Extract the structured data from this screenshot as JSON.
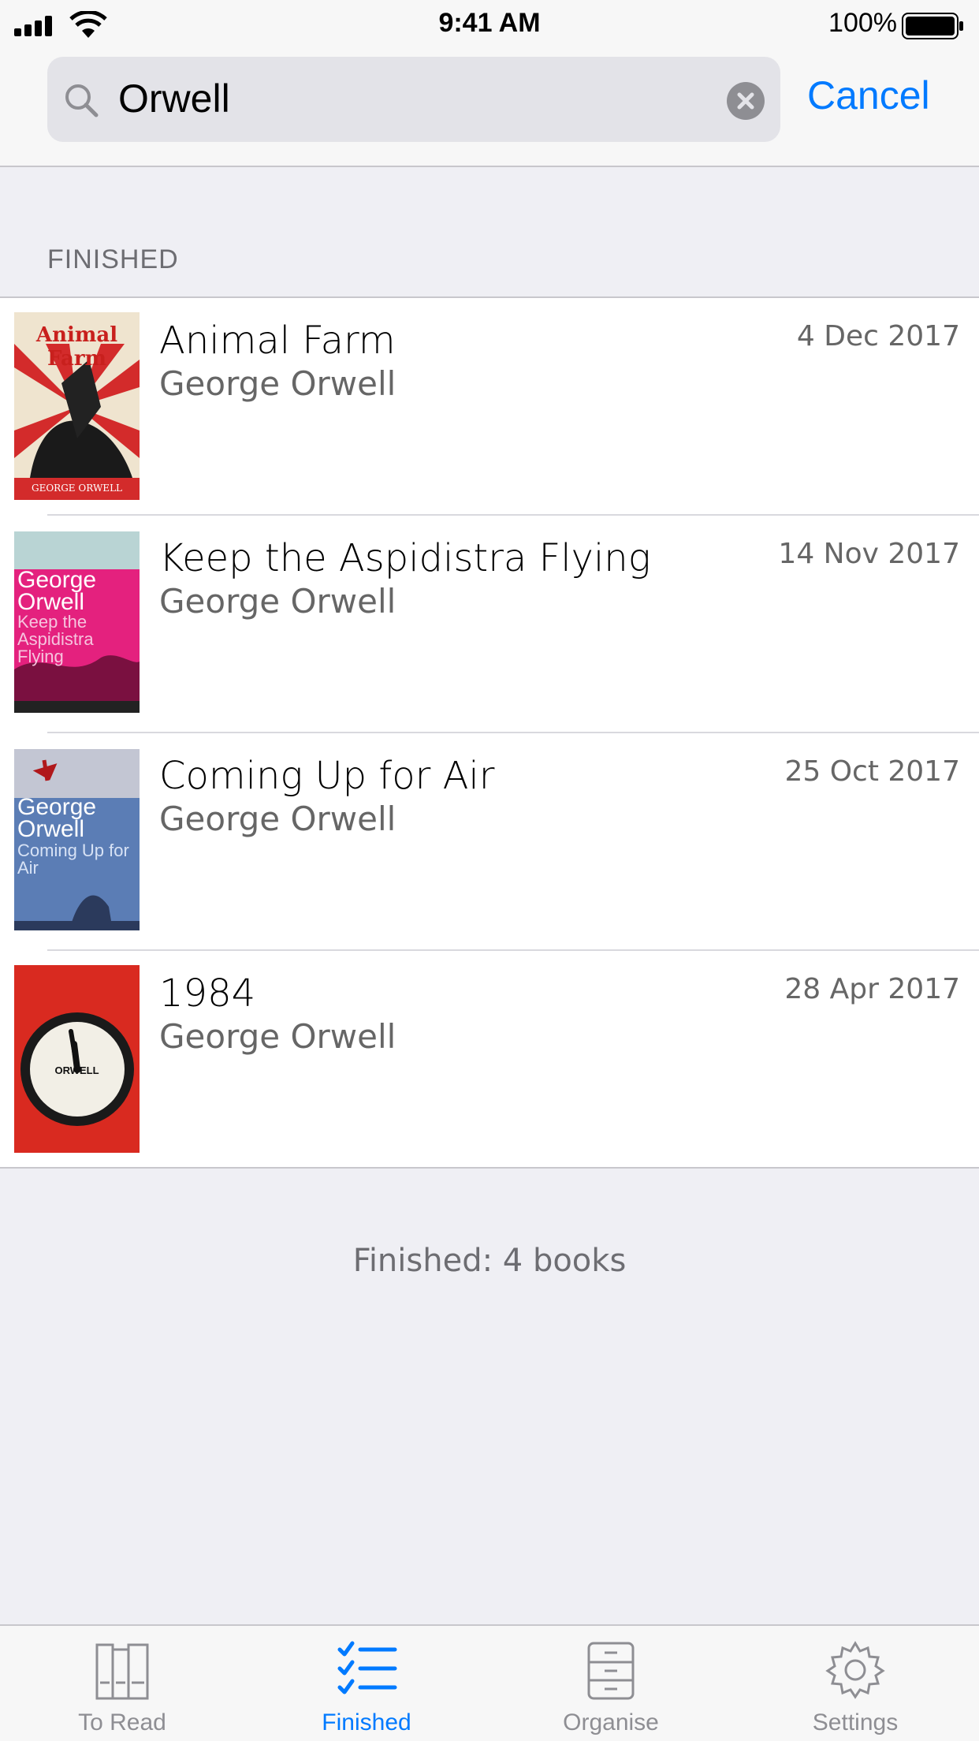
{
  "status_bar": {
    "time": "9:41 AM",
    "battery": "100%"
  },
  "search": {
    "value": "Orwell",
    "cancel_label": "Cancel"
  },
  "section": {
    "header": "FINISHED"
  },
  "books": [
    {
      "title": "Animal Farm",
      "author": "George Orwell",
      "date": "4 Dec 2017",
      "cover_text": "Animal Farm",
      "cover_sub": "GEORGE ORWELL"
    },
    {
      "title": "Keep the Aspidistra Flying",
      "author": "George Orwell",
      "date": "14 Nov 2017",
      "cover_text": "George Orwell",
      "cover_sub": "Keep the Aspidistra Flying"
    },
    {
      "title": "Coming Up for Air",
      "author": "George Orwell",
      "date": "25 Oct 2017",
      "cover_text": "George Orwell",
      "cover_sub": "Coming Up for Air"
    },
    {
      "title": "1984",
      "author": "George Orwell",
      "date": "28 Apr 2017",
      "cover_text": "ORWELL"
    }
  ],
  "footer": {
    "count_text": "Finished: 4 books"
  },
  "tabs": [
    {
      "label": "To Read",
      "icon": "bookshelf-icon",
      "active": false
    },
    {
      "label": "Finished",
      "icon": "checklist-icon",
      "active": true
    },
    {
      "label": "Organise",
      "icon": "filing-cabinet-icon",
      "active": false
    },
    {
      "label": "Settings",
      "icon": "gear-icon",
      "active": false
    }
  ],
  "colors": {
    "accent": "#007aff",
    "background": "#efeff4"
  }
}
